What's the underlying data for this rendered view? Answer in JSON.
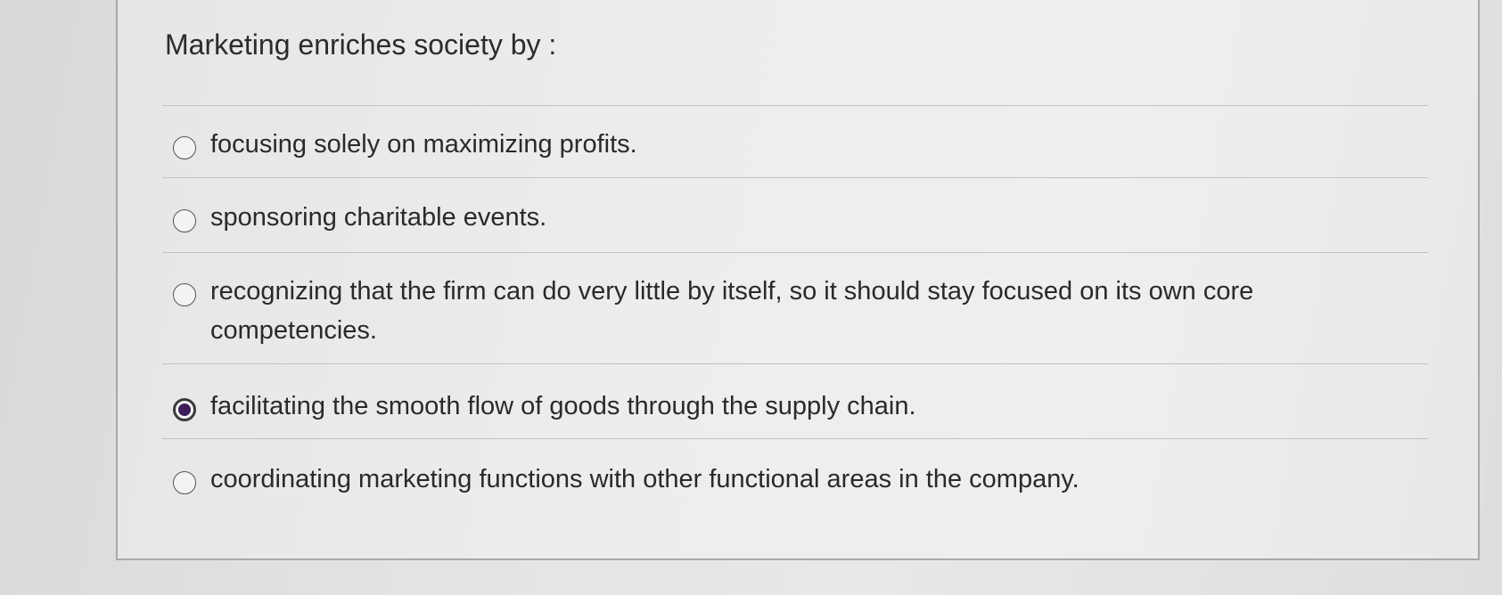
{
  "question": {
    "text": "Marketing enriches society by :"
  },
  "options": [
    {
      "label": "focusing solely on maximizing profits.",
      "selected": false
    },
    {
      "label": "sponsoring charitable events.",
      "selected": false
    },
    {
      "label": "recognizing that the firm can do very little by itself, so it should stay focused on its own core competencies.",
      "selected": false
    },
    {
      "label": "facilitating the smooth flow of goods through the supply chain.",
      "selected": true
    },
    {
      "label": "coordinating marketing functions with other functional areas in the company.",
      "selected": false
    }
  ]
}
